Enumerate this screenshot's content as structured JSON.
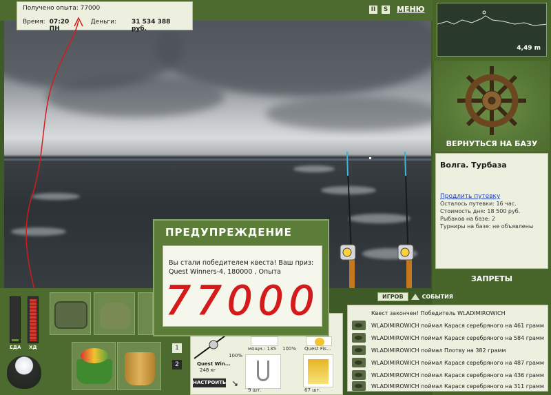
{
  "hud": {
    "exp_gained": "Получено опыта: 77000",
    "time_label": "Время:",
    "time_value": "07:20 ПН",
    "money_label": "Деньги:",
    "money_value": "31 534 388 руб.",
    "pause_icon": "II",
    "sound_icon": "S",
    "menu_label": "МЕНЮ"
  },
  "depth": {
    "value": "4,49 m"
  },
  "base": {
    "return_label": "ВЕРНУТЬСЯ НА БАЗУ",
    "location": "Волга. Турбаза",
    "extend_link": "Продлить путевку",
    "lines": [
      "Осталось путевки: 16 час.",
      "Стоимость дня: 18 500 руб.",
      "Рыбаков на базе: 2",
      "Турниры на базе: не объявлены"
    ],
    "bans_label": "ЗАПРЕТЫ"
  },
  "events": {
    "tab_game": "ИГРОВ",
    "tab_events": "СОБЫТИЯ",
    "rows": [
      "Квест закончен! Победитель WLADIMIROWICH",
      "WLADIMIROWICH поймал Карася серебряного на 461 грамм",
      "WLADIMIROWICH поймал Карася серебряного на 584 грамм",
      "WLADIMIROWICH поймал Плотву на 382 грамм",
      "WLADIMIROWICH поймал Карася серебряного на 487 грамм",
      "WLADIMIROWICH поймал Карася серебряного на 436 грамм",
      "WLADIMIROWICH поймал Карася серебряного на 311 грамм"
    ]
  },
  "status": {
    "food_label": "ЕДА",
    "hp_label": "ХД",
    "food_level": 0.05,
    "hp_level": 0.95,
    "page1": "1",
    "page2": "2"
  },
  "tackle": {
    "rod_name": "Quest Win...",
    "rod_weight": "248 кг",
    "tune_label": "НАСТРОИТЬ",
    "pct1": "100%",
    "power_label": "мощн.: 135",
    "pct2": "100%",
    "bait_label": "Quest Fis...",
    "count1": "9 шт.",
    "count2": "67 шт."
  },
  "dialog": {
    "title": "ПРЕДУПРЕЖДЕНИЕ",
    "message": "Вы стали победителем квеста! Ваш приз: Quest Winners-4, 180000 , Опыта",
    "handwritten": "77000"
  },
  "colors": {
    "panel_green": "#486629",
    "card_bg": "#eef0df",
    "annotation_red": "#d41b1b",
    "hp_red": "#c0302a"
  }
}
